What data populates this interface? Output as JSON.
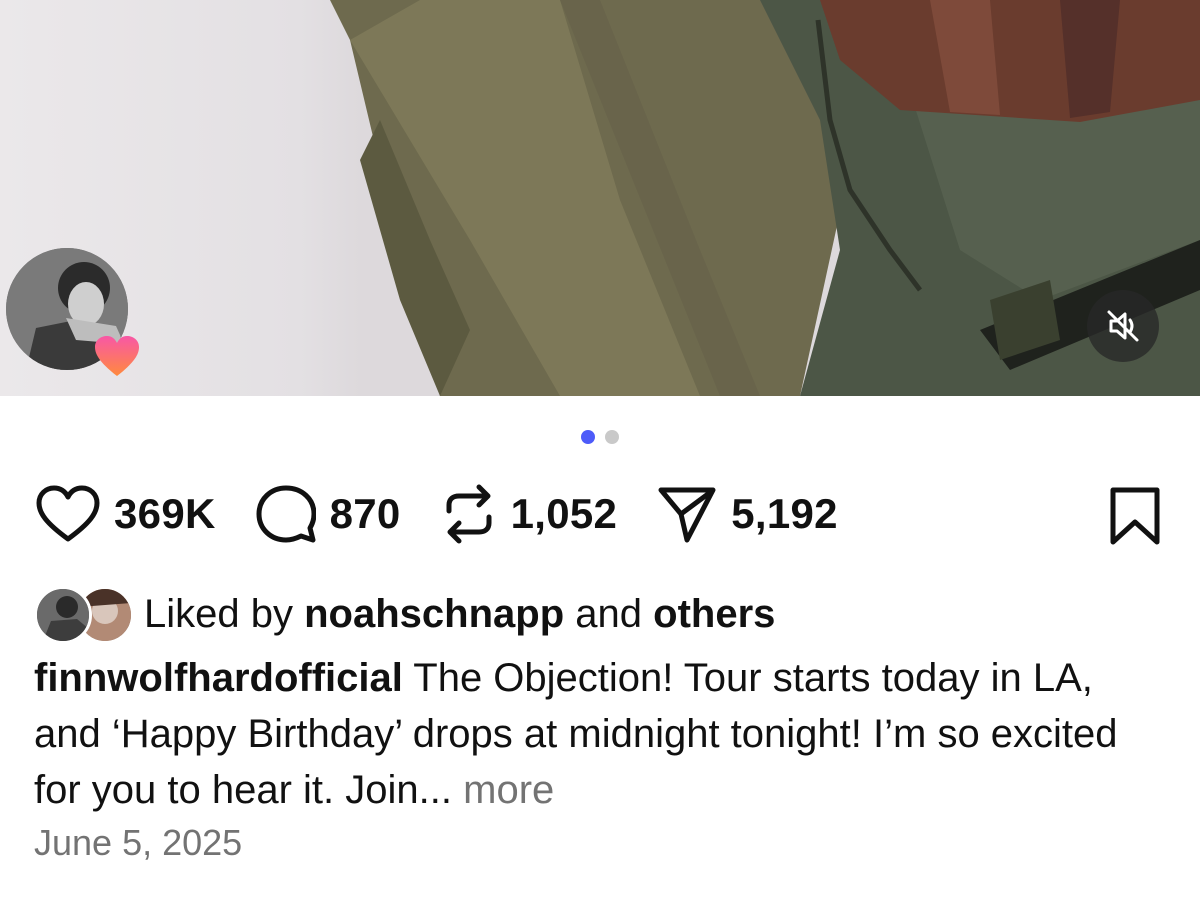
{
  "post": {
    "media": {
      "carousel_count": 2,
      "active_index": 0,
      "sound_state": "muted"
    },
    "story_avatar": {
      "badge": "heart-icon"
    },
    "actions": {
      "likes": "369K",
      "comments": "870",
      "reposts": "1,052",
      "shares": "5,192"
    },
    "liked_by": {
      "prefix": "Liked by",
      "user": "noahschnapp",
      "joiner": "and",
      "others": "others"
    },
    "caption": {
      "username": "finnwolfhardofficial",
      "text": "The Objection! Tour starts today in LA, and ‘Happy Birthday’ drops at midnight tonight! I’m so excited for you to hear it. Join...",
      "more_label": "more"
    },
    "date": "June 5, 2025",
    "colors": {
      "accent_dot": "#4d5bf9",
      "inactive_dot": "#c9c9c9",
      "muted_text": "#737373",
      "heart_badge_top": "#f857a6",
      "heart_badge_bottom": "#ff8a3d"
    }
  }
}
